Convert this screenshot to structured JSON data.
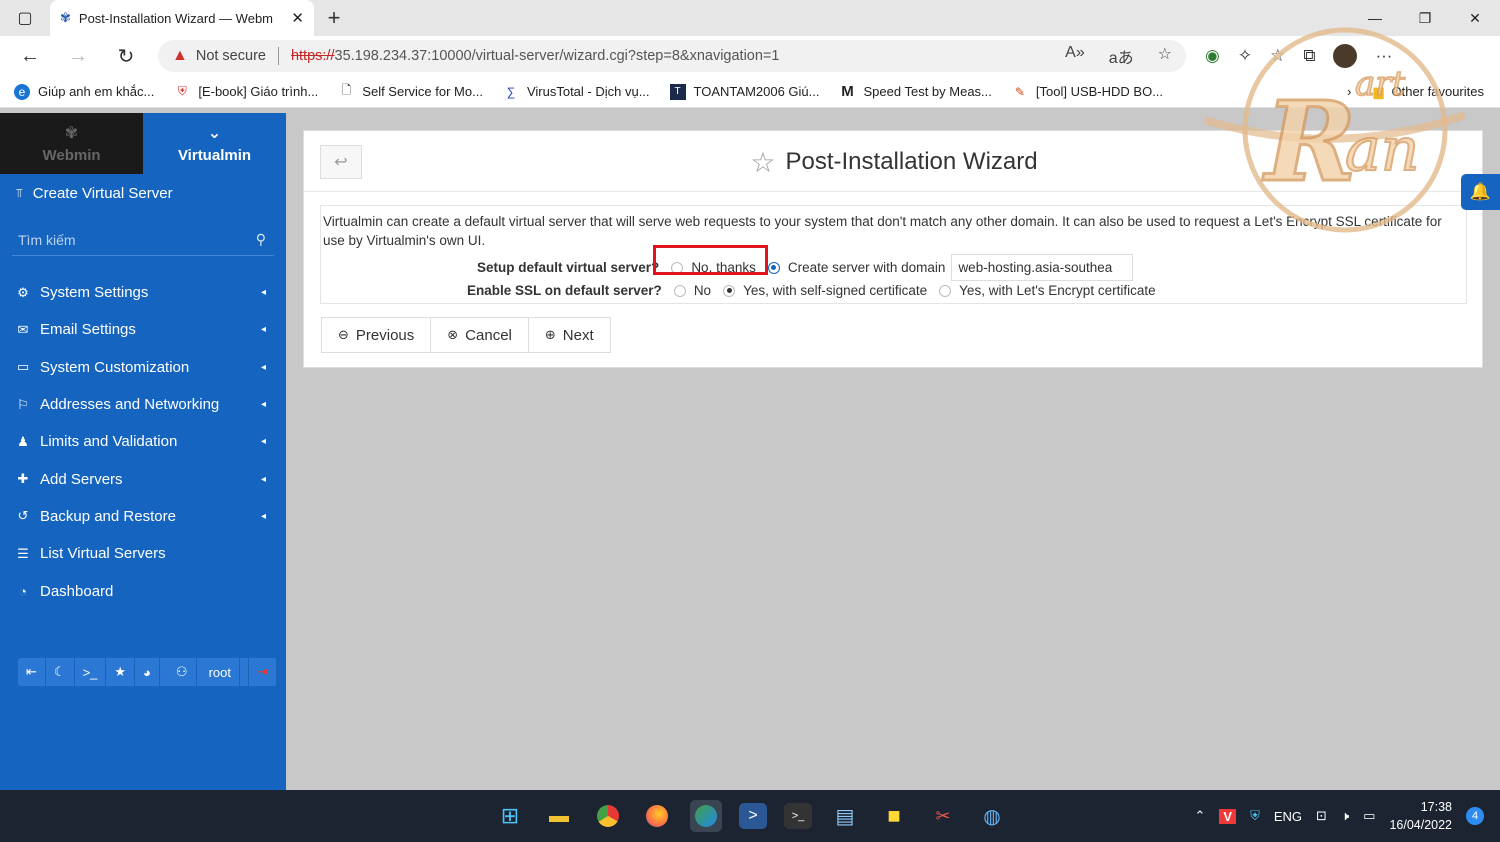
{
  "browser": {
    "tab_title": "Post-Installation Wizard — Webm",
    "not_secure": "Not secure",
    "url_scheme": "https://",
    "url_rest": "35.198.234.37:10000/virtual-server/wizard.cgi?step=8&xnavigation=1",
    "bookmarks": [
      {
        "label": "Giúp anh em khắc...",
        "icon": "edge-icon"
      },
      {
        "label": "[E-book] Giáo trình...",
        "icon": "shield-icon"
      },
      {
        "label": "Self Service for Mo...",
        "icon": "page-icon"
      },
      {
        "label": "VirusTotal - Dịch vụ...",
        "icon": "virustotal-icon"
      },
      {
        "label": "TOANTAM2006 Giú...",
        "icon": "toantam-icon"
      },
      {
        "label": "Speed Test by Meas...",
        "icon": "m-icon"
      },
      {
        "label": "[Tool] USB-HDD BO...",
        "icon": "tool-icon"
      }
    ],
    "other_favourites": "Other favourites"
  },
  "sidebar": {
    "tab_webmin": "Webmin",
    "tab_virtualmin": "Virtualmin",
    "create": "Create Virtual Server",
    "search_placeholder": "Tìm kiếm",
    "items": [
      {
        "label": "System Settings",
        "icon": "gear-icon",
        "arrow": true
      },
      {
        "label": "Email Settings",
        "icon": "envelope-icon",
        "arrow": true
      },
      {
        "label": "System Customization",
        "icon": "laptop-icon",
        "arrow": true
      },
      {
        "label": "Addresses and Networking",
        "icon": "network-icon",
        "arrow": true
      },
      {
        "label": "Limits and Validation",
        "icon": "user-lock-icon",
        "arrow": true
      },
      {
        "label": "Add Servers",
        "icon": "plus-icon",
        "arrow": true
      },
      {
        "label": "Backup and Restore",
        "icon": "history-icon",
        "arrow": true
      },
      {
        "label": "List Virtual Servers",
        "icon": "list-icon",
        "arrow": false
      },
      {
        "label": "Dashboard",
        "icon": "dashboard-icon",
        "arrow": false
      }
    ],
    "user": "root"
  },
  "page": {
    "title": "Post-Installation Wizard",
    "description": "Virtualmin can create a default virtual server that will serve web requests to your system that don't match any other domain. It can also be used to request a Let's Encrypt SSL certificate for use by Virtualmin's own UI.",
    "setup_label": "Setup default virtual server?",
    "setup_options": [
      "No, thanks",
      "Create server with domain"
    ],
    "domain_value": "web-hosting.asia-southea",
    "ssl_label": "Enable SSL on default server?",
    "ssl_options": [
      "No",
      "Yes, with self-signed certificate",
      "Yes, with Let's Encrypt certificate"
    ],
    "buttons": {
      "previous": "Previous",
      "cancel": "Cancel",
      "next": "Next"
    }
  },
  "taskbar": {
    "lang": "ENG",
    "time": "17:38",
    "date": "16/04/2022",
    "notifications": "4"
  }
}
